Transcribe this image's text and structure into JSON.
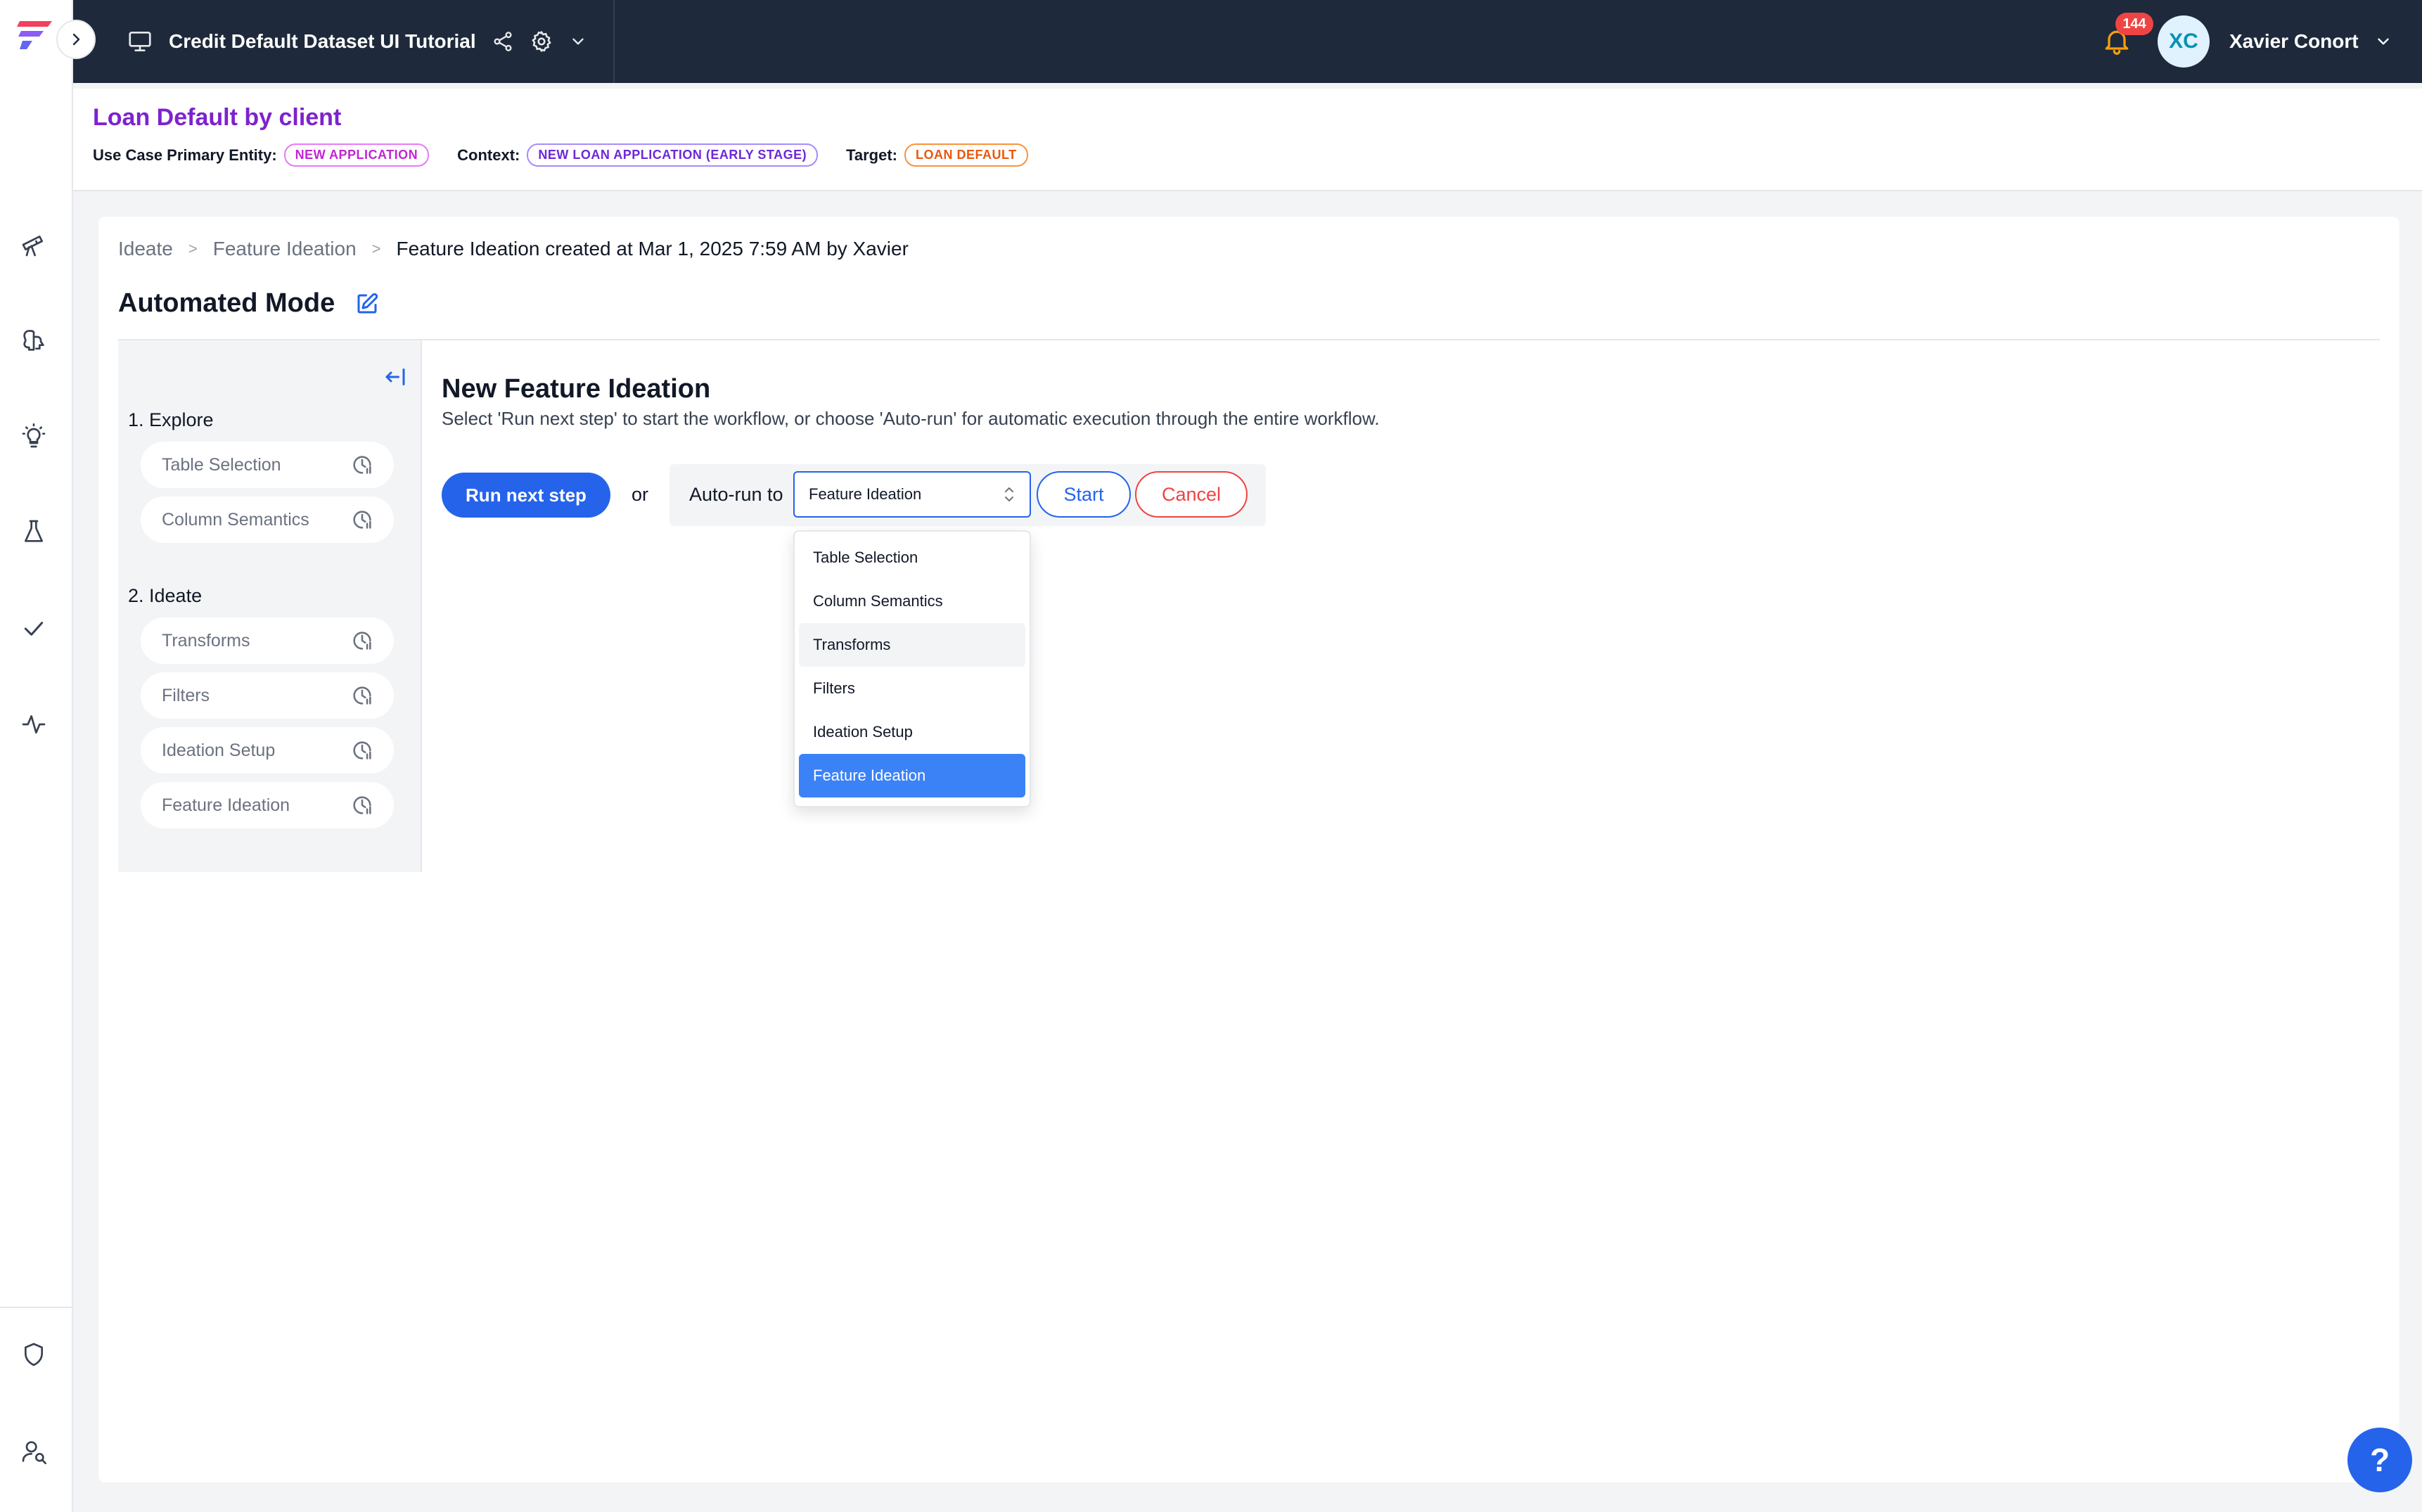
{
  "topbar": {
    "catalog_name": "Credit Default Dataset UI Tutorial",
    "notification_count": "144",
    "avatar_initials": "XC",
    "user_name": "Xavier Conort"
  },
  "use_case": {
    "title": "Loan Default by client",
    "primary_entity_label": "Use Case Primary Entity:",
    "primary_entity_value": "NEW APPLICATION",
    "context_label": "Context:",
    "context_value": "NEW LOAN APPLICATION (EARLY STAGE)",
    "target_label": "Target:",
    "target_value": "LOAN DEFAULT"
  },
  "breadcrumb": {
    "items": [
      "Ideate",
      "Feature Ideation"
    ],
    "separator": ">",
    "current": "Feature Ideation created at Mar 1, 2025 7:59 AM by Xavier"
  },
  "mode": {
    "title": "Automated Mode"
  },
  "steps": {
    "groups": [
      {
        "label": "1. Explore",
        "items": [
          "Table Selection",
          "Column Semantics"
        ]
      },
      {
        "label": "2. Ideate",
        "items": [
          "Transforms",
          "Filters",
          "Ideation Setup",
          "Feature Ideation"
        ]
      }
    ]
  },
  "content": {
    "title": "New Feature Ideation",
    "description": "Select 'Run next step' to start the workflow, or choose 'Auto-run' for automatic execution through the entire workflow.",
    "run_next_label": "Run next step",
    "or_label": "or",
    "autorun_label": "Auto-run to",
    "select_value": "Feature Ideation",
    "start_label": "Start",
    "cancel_label": "Cancel"
  },
  "dropdown": {
    "options": [
      "Table Selection",
      "Column Semantics",
      "Transforms",
      "Filters",
      "Ideation Setup",
      "Feature Ideation"
    ],
    "hovered": "Transforms",
    "selected": "Feature Ideation"
  },
  "help": {
    "label": "?"
  },
  "colors": {
    "accent": "#2563eb",
    "topbar": "#1e293b",
    "title_purple": "#7e22ce",
    "danger": "#ef4444",
    "notification": "#f59e0b"
  }
}
